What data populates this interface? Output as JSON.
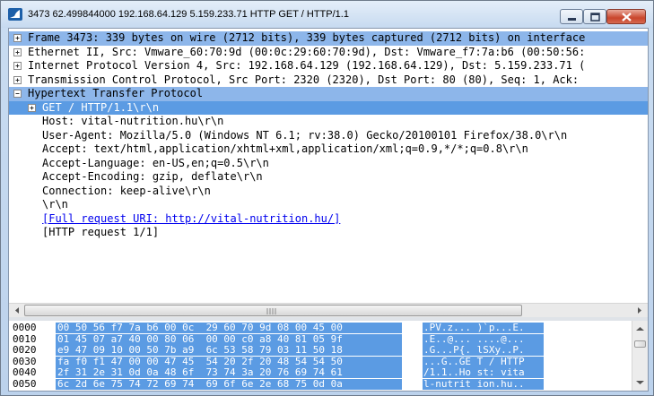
{
  "window": {
    "title": "3473 62.499844000 192.168.64.129 5.159.233.71 HTTP GET / HTTP/1.1"
  },
  "tree": [
    {
      "text": "Frame 3473: 339 bytes on wire (2712 bits), 339 bytes captured (2712 bits) on interface",
      "expander": "plus"
    },
    {
      "text": "Ethernet II, Src: Vmware_60:70:9d (00:0c:29:60:70:9d), Dst: Vmware_f7:7a:b6 (00:50:56:",
      "expander": "plus"
    },
    {
      "text": "Internet Protocol Version 4, Src: 192.168.64.129 (192.168.64.129), Dst: 5.159.233.71 (",
      "expander": "plus"
    },
    {
      "text": "Transmission Control Protocol, Src Port: 2320 (2320), Dst Port: 80 (80), Seq: 1, Ack:",
      "expander": "plus"
    },
    {
      "text": "Hypertext Transfer Protocol",
      "expander": "minus"
    },
    {
      "text": "GET / HTTP/1.1\\r\\n",
      "expander": "plus"
    },
    {
      "text": "Host: vital-nutrition.hu\\r\\n",
      "expander": ""
    },
    {
      "text": "User-Agent: Mozilla/5.0 (Windows NT 6.1; rv:38.0) Gecko/20100101 Firefox/38.0\\r\\n",
      "expander": ""
    },
    {
      "text": "Accept: text/html,application/xhtml+xml,application/xml;q=0.9,*/*;q=0.8\\r\\n",
      "expander": ""
    },
    {
      "text": "Accept-Language: en-US,en;q=0.5\\r\\n",
      "expander": ""
    },
    {
      "text": "Accept-Encoding: gzip, deflate\\r\\n",
      "expander": ""
    },
    {
      "text": "Connection: keep-alive\\r\\n",
      "expander": ""
    },
    {
      "text": "\\r\\n",
      "expander": ""
    },
    {
      "text": "[Full request URI: http://vital-nutrition.hu/]",
      "expander": ""
    },
    {
      "text": "[HTTP request 1/1]",
      "expander": ""
    }
  ],
  "bytes": [
    {
      "offset": "0000",
      "hex": "00 50 56 f7 7a b6 00 0c  29 60 70 9d 08 00 45 00",
      "ascii": ".PV.z... )`p...E."
    },
    {
      "offset": "0010",
      "hex": "01 45 07 a7 40 00 80 06  00 00 c0 a8 40 81 05 9f",
      "ascii": ".E..@... ....@..."
    },
    {
      "offset": "0020",
      "hex": "e9 47 09 10 00 50 7b a9  6c 53 58 79 03 11 50 18",
      "ascii": ".G...P{. lSXy..P."
    },
    {
      "offset": "0030",
      "hex": "fa f0 f1 47 00 00 47 45  54 20 2f 20 48 54 54 50",
      "ascii": "...G..GE T / HTTP"
    },
    {
      "offset": "0040",
      "hex": "2f 31 2e 31 0d 0a 48 6f  73 74 3a 20 76 69 74 61",
      "ascii": "/1.1..Ho st: vita"
    },
    {
      "offset": "0050",
      "hex": "6c 2d 6e 75 74 72 69 74  69 6f 6e 2e 68 75 0d 0a",
      "ascii": "l-nutrit ion.hu.."
    }
  ],
  "colors": {
    "selection": "#5b9be3",
    "selection_light": "#8db6ea",
    "link": "#0000ee"
  }
}
